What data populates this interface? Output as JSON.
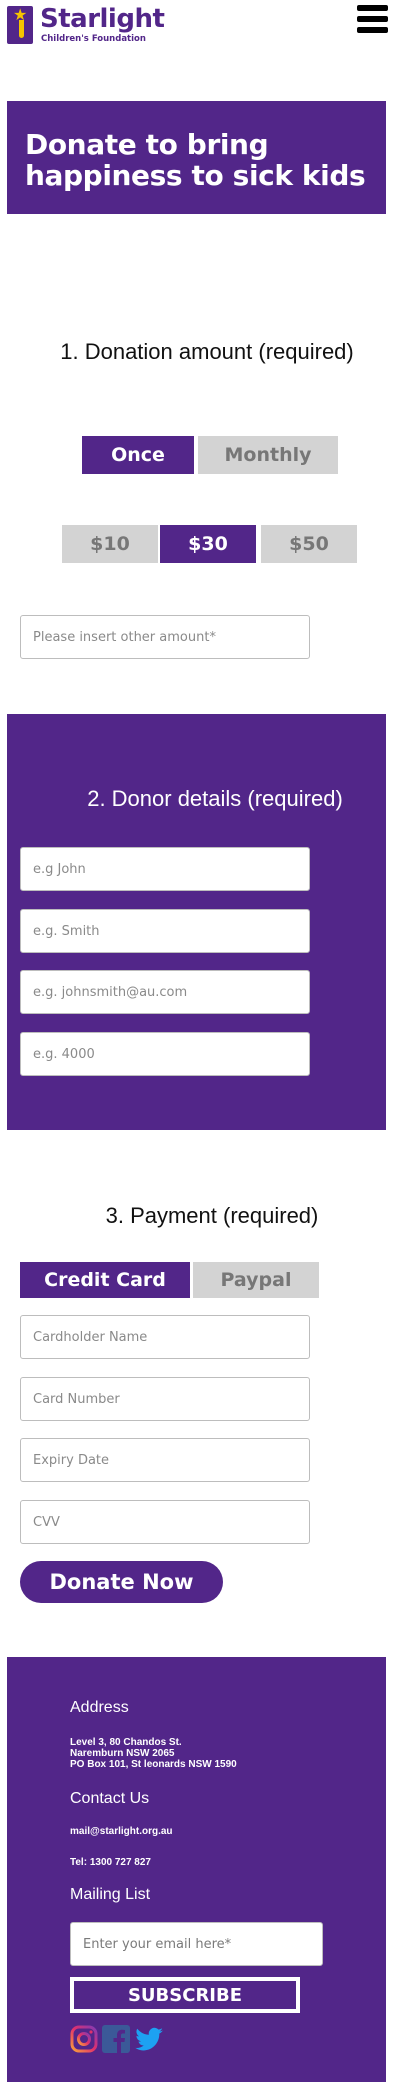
{
  "header": {
    "logo_name": "Starlight",
    "logo_subtitle": "Children's Foundation"
  },
  "hero": {
    "title": "Donate to bring happiness to sick kids"
  },
  "donation": {
    "title": "1. Donation amount (required)",
    "frequency": [
      "Once",
      "Monthly"
    ],
    "selected_frequency": "Once",
    "amounts": [
      "$10",
      "$30",
      "$50"
    ],
    "selected_amount": "$30",
    "other_placeholder": "Please insert other amount*"
  },
  "donor": {
    "title": "2. Donor details (required)",
    "first_name_placeholder": "e.g John",
    "last_name_placeholder": "e.g. Smith",
    "email_placeholder": "e.g. johnsmith@au.com",
    "postcode_placeholder": "e.g. 4000"
  },
  "payment": {
    "title": "3. Payment (required)",
    "methods": [
      "Credit Card",
      "Paypal"
    ],
    "selected_method": "Credit Card",
    "cardholder_placeholder": "Cardholder Name",
    "card_number_placeholder": "Card Number",
    "expiry_placeholder": "Expiry Date",
    "cvv_placeholder": "CVV",
    "donate_label": "Donate Now"
  },
  "footer": {
    "address_title": "Address",
    "address_text": "Level 3, 80 Chandos St.\nNaremburn NSW 2065\nPO Box 101, St leonards NSW 1590",
    "contact_title": "Contact Us",
    "email": "mail@starlight.org.au",
    "phone": "Tel: 1300 727 827",
    "mailing_title": "Mailing List",
    "mailing_placeholder": "Enter your email here*",
    "subscribe_label": "SUBSCRIBE",
    "social_icons": [
      "instagram-icon",
      "facebook-icon",
      "twitter-icon"
    ]
  },
  "colors": {
    "brand_purple": "#522689",
    "accent_yellow": "#f5c400",
    "inactive_gray": "#d3d3d3"
  }
}
